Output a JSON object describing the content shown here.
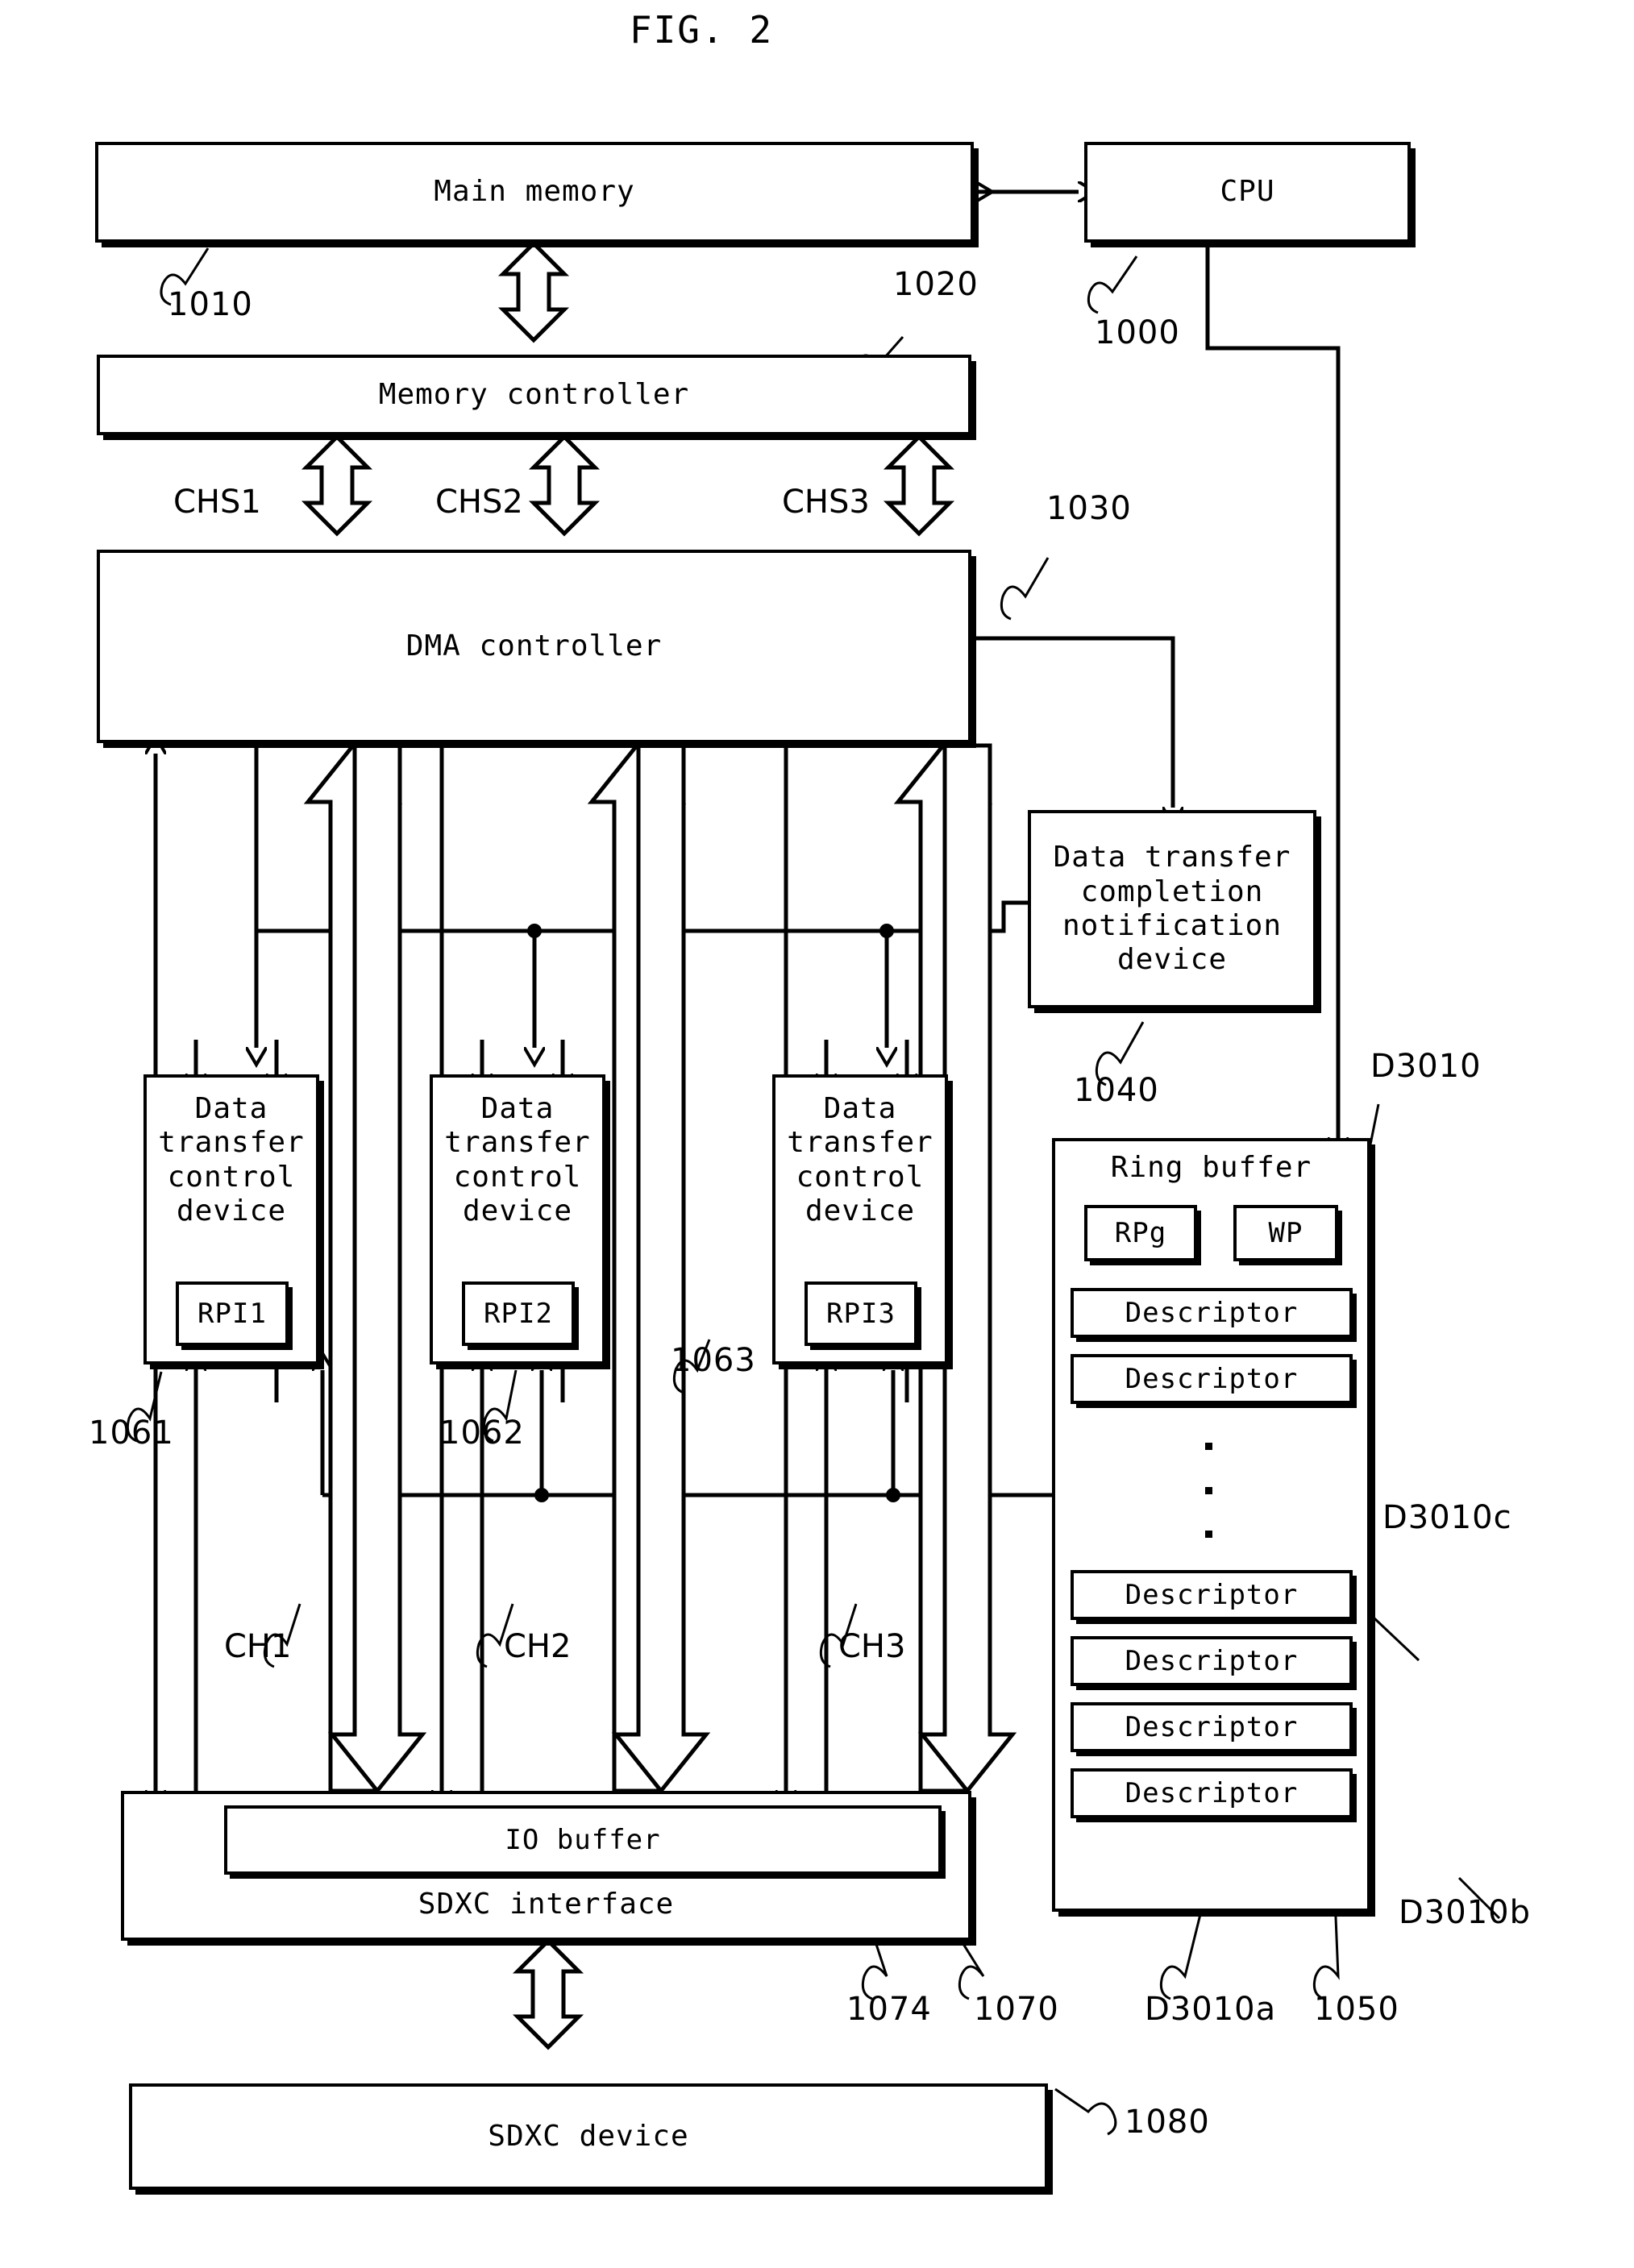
{
  "figure": {
    "title": "FIG. 2"
  },
  "boxes": {
    "main_memory": "Main memory",
    "cpu": "CPU",
    "memory_controller": "Memory controller",
    "dma_controller": "DMA controller",
    "notification_device": "Data transfer\ncompletion\nnotification\ndevice",
    "dtc1": "Data\ntransfer\ncontrol\ndevice",
    "dtc2": "Data\ntransfer\ncontrol\ndevice",
    "dtc3": "Data\ntransfer\ncontrol\ndevice",
    "rpi1": "RPI1",
    "rpi2": "RPI2",
    "rpi3": "RPI3",
    "ring_buffer": "Ring buffer",
    "rpg": "RPg",
    "wp": "WP",
    "descriptor": "Descriptor",
    "io_buffer": "IO buffer",
    "sdxc_interface": "SDXC interface",
    "sdxc_device": "SDXC device"
  },
  "descriptors": [
    "Descriptor",
    "Descriptor",
    "Descriptor",
    "Descriptor",
    "Descriptor",
    "Descriptor"
  ],
  "channel_labels": {
    "chs1": "CHS1",
    "chs2": "CHS2",
    "chs3": "CHS3",
    "ch1": "CH1",
    "ch2": "CH2",
    "ch3": "CH3"
  },
  "reference_numerals": {
    "main_memory": "1010",
    "memory_controller": "1020",
    "cpu": "1000",
    "dma_controller": "1030",
    "notification_device": "1040",
    "dtc1": "1061",
    "dtc2": "1062",
    "dtc3": "1063",
    "ring_buffer": "1050",
    "sdxc_interface": "1070",
    "io_buffer": "1074",
    "sdxc_device": "1080",
    "descriptor_group": "D3010",
    "descriptor_a": "D3010a",
    "descriptor_b": "D3010b",
    "descriptor_c": "D3010c"
  },
  "colors": {
    "line": "#000000",
    "background": "#ffffff"
  }
}
